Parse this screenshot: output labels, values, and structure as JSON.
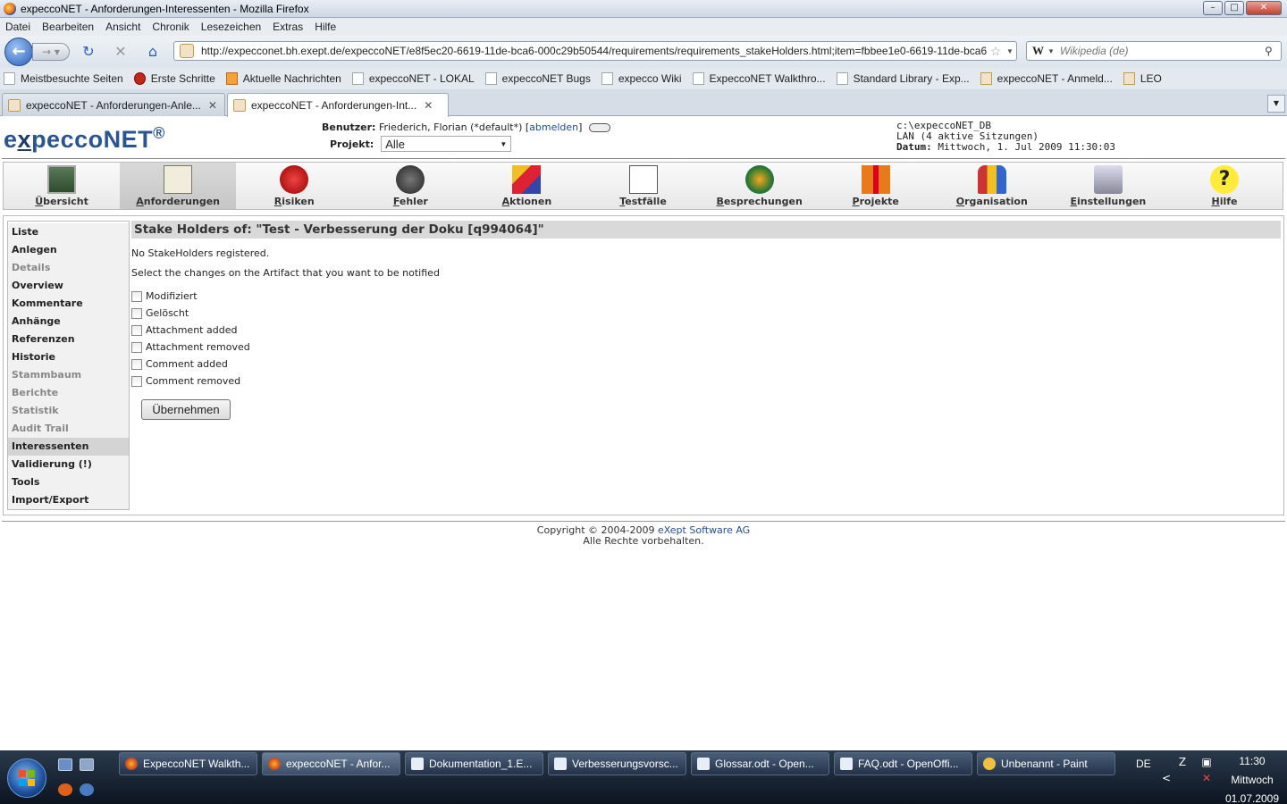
{
  "window": {
    "title": "expeccoNET - Anforderungen-Interessenten - Mozilla Firefox",
    "controls": {
      "minimize": "–",
      "maximize": "□",
      "close": "✕"
    }
  },
  "menu": [
    "Datei",
    "Bearbeiten",
    "Ansicht",
    "Chronik",
    "Lesezeichen",
    "Extras",
    "Hilfe"
  ],
  "nav": {
    "url": "http://expecconet.bh.exept.de/expeccoNET/e8f5ec20-6619-11de-bca6-000c29b50544/requirements/requirements_stakeHolders.html;item=fbbee1e0-6619-11de-bca6",
    "search_engine": "W",
    "search_placeholder": "Wikipedia (de)"
  },
  "bookmarks": [
    {
      "label": "Meistbesuchte Seiten",
      "icon": "globe-icon"
    },
    {
      "label": "Erste Schritte",
      "icon": "red-icon"
    },
    {
      "label": "Aktuelle Nachrichten",
      "icon": "feed-icon"
    },
    {
      "label": "expeccoNET - LOKAL",
      "icon": "page-icon"
    },
    {
      "label": "expeccoNET Bugs",
      "icon": "page-icon"
    },
    {
      "label": "expecco Wiki",
      "icon": "page-icon"
    },
    {
      "label": "ExpeccoNET Walkthro...",
      "icon": "page-icon"
    },
    {
      "label": "Standard Library - Exp...",
      "icon": "page-icon"
    },
    {
      "label": "expeccoNET - Anmeld...",
      "icon": "expecco-icon"
    },
    {
      "label": "LEO",
      "icon": "leo-icon"
    }
  ],
  "tabs": [
    {
      "label": "expeccoNET - Anforderungen-Anle...",
      "active": false
    },
    {
      "label": "expeccoNET - Anforderungen-Int...",
      "active": true
    }
  ],
  "header": {
    "logo_pre": "e",
    "logo_x": "x",
    "logo_post": "peccoNET",
    "logo_reg": "®",
    "user_label": "Benutzer:",
    "user_value": "Friederich, Florian (*default*)",
    "logout_link": "abmelden",
    "project_label": "Projekt:",
    "project_value": "Alle",
    "db_path": "c:\\expeccoNET_DB",
    "lan": "LAN (4 aktive Sitzungen)",
    "date_label": "Datum:",
    "date_value": "Mittwoch, 1. Jul 2009 11:30:03"
  },
  "modules": [
    {
      "label": "Übersicht",
      "first": "Ü",
      "rest": "bersicht",
      "icon": "chart-icon",
      "active": false
    },
    {
      "label": "Anforderungen",
      "first": "A",
      "rest": "nforderungen",
      "icon": "clipboard-icon",
      "active": true
    },
    {
      "label": "Risiken",
      "first": "R",
      "rest": "isiken",
      "icon": "alarm-icon",
      "active": false
    },
    {
      "label": "Fehler",
      "first": "F",
      "rest": "ehler",
      "icon": "bug-icon",
      "active": false
    },
    {
      "label": "Aktionen",
      "first": "A",
      "rest": "ktionen",
      "icon": "blocks-icon",
      "active": false
    },
    {
      "label": "Testfälle",
      "first": "T",
      "rest": "estfälle",
      "icon": "testcase-icon",
      "active": false
    },
    {
      "label": "Besprechungen",
      "first": "B",
      "rest": "esprechungen",
      "icon": "meeting-icon",
      "active": false
    },
    {
      "label": "Projekte",
      "first": "P",
      "rest": "rojekte",
      "icon": "gift-icon",
      "active": false
    },
    {
      "label": "Organisation",
      "first": "O",
      "rest": "rganisation",
      "icon": "people-icon",
      "active": false
    },
    {
      "label": "Einstellungen",
      "first": "E",
      "rest": "instellungen",
      "icon": "settings-icon",
      "active": false
    },
    {
      "label": "Hilfe",
      "first": "H",
      "rest": "ilfe",
      "icon": "help-icon",
      "active": false
    }
  ],
  "sidebar": [
    {
      "label": "Liste",
      "state": "normal"
    },
    {
      "label": "Anlegen",
      "state": "normal"
    },
    {
      "label": "Details",
      "state": "disabled"
    },
    {
      "label": "Overview",
      "state": "normal"
    },
    {
      "label": "Kommentare",
      "state": "normal"
    },
    {
      "label": "Anhänge",
      "state": "normal"
    },
    {
      "label": "Referenzen",
      "state": "normal"
    },
    {
      "label": "Historie",
      "state": "normal"
    },
    {
      "label": "Stammbaum",
      "state": "disabled"
    },
    {
      "label": "Berichte",
      "state": "disabled"
    },
    {
      "label": "Statistik",
      "state": "disabled"
    },
    {
      "label": "Audit Trail",
      "state": "disabled"
    },
    {
      "label": "Interessenten",
      "state": "active"
    },
    {
      "label": "Validierung (!)",
      "state": "normal"
    },
    {
      "label": "Tools",
      "state": "normal"
    },
    {
      "label": "Import/Export",
      "state": "normal"
    }
  ],
  "main": {
    "heading": "Stake Holders of: \"Test - Verbesserung der Doku [q994064]\"",
    "no_holders": "No StakeHolders registered.",
    "instruction": "Select the changes on the Artifact that you want to be notified",
    "options": [
      {
        "label": "Modifiziert",
        "checked": false
      },
      {
        "label": "Gelöscht",
        "checked": false
      },
      {
        "label": "Attachment added",
        "checked": false
      },
      {
        "label": "Attachment removed",
        "checked": false
      },
      {
        "label": "Comment added",
        "checked": false
      },
      {
        "label": "Comment removed",
        "checked": false
      }
    ],
    "submit": "Übernehmen"
  },
  "footer": {
    "copyright": "Copyright © 2004-2009",
    "company": "eXept Software AG",
    "rights": "Alle Rechte vorbehalten."
  },
  "taskbar": {
    "tasks": [
      {
        "label": "ExpeccoNET Walkth...",
        "icon": "firefox-icon",
        "active": false
      },
      {
        "label": "expeccoNET - Anfor...",
        "icon": "firefox-icon",
        "active": true
      },
      {
        "label": "Dokumentation_1.E...",
        "icon": "document-icon",
        "active": false
      },
      {
        "label": "Verbesserungsvorsc...",
        "icon": "document-icon",
        "active": false
      },
      {
        "label": "Glossar.odt - Open...",
        "icon": "document-icon",
        "active": false
      },
      {
        "label": "FAQ.odt - OpenOffi...",
        "icon": "document-icon",
        "active": false
      },
      {
        "label": "Unbenannt - Paint",
        "icon": "paint-icon",
        "active": false
      }
    ],
    "language": "DE",
    "time": "11:30",
    "weekday": "Mittwoch",
    "date": "01.07.2009"
  }
}
